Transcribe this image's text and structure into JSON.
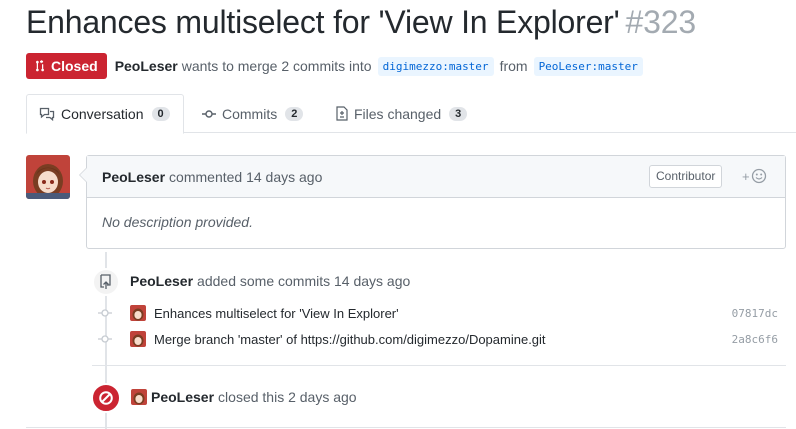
{
  "pr": {
    "title": "Enhances multiselect for 'View In Explorer'",
    "number": "#323",
    "state": "Closed",
    "author": "PeoLeser",
    "merge_text": "wants to merge 2 commits into",
    "base_branch": "digimezzo:master",
    "from_text": "from",
    "head_branch": "PeoLeser:master"
  },
  "tabs": [
    {
      "label": "Conversation",
      "count": "0"
    },
    {
      "label": "Commits",
      "count": "2"
    },
    {
      "label": "Files changed",
      "count": "3"
    }
  ],
  "comment": {
    "author": "PeoLeser",
    "action": "commented 14 days ago",
    "role": "Contributor",
    "body": "No description provided."
  },
  "commits_event": {
    "author": "PeoLeser",
    "action": "added some commits 14 days ago",
    "commits": [
      {
        "message": "Enhances multiselect for 'View In Explorer'",
        "sha": "07817dc"
      },
      {
        "message": "Merge branch 'master' of https://github.com/digimezzo/Dopamine.git",
        "sha": "2a8c6f6"
      }
    ]
  },
  "closed_event": {
    "author": "PeoLeser",
    "action": "closed this 2 days ago"
  },
  "colors": {
    "closed_red": "#cb2431",
    "link_blue": "#0366d6",
    "border": "#e1e4e8"
  }
}
